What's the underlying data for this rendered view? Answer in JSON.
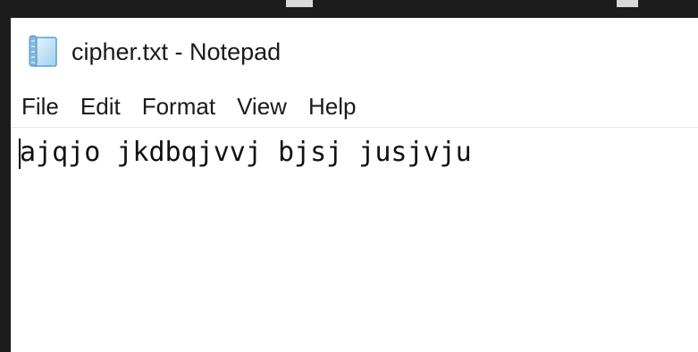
{
  "window": {
    "title": "cipher.txt - Notepad",
    "icon": "notepad-icon"
  },
  "menu": {
    "items": [
      {
        "label": "File"
      },
      {
        "label": "Edit"
      },
      {
        "label": "Format"
      },
      {
        "label": "View"
      },
      {
        "label": "Help"
      }
    ]
  },
  "editor": {
    "text": "ajqjo jkdbqjvvj bjsj jusjvju"
  },
  "colors": {
    "background": "#ffffff",
    "text": "#1a1a1a",
    "desktop": "#1c1c1c"
  }
}
